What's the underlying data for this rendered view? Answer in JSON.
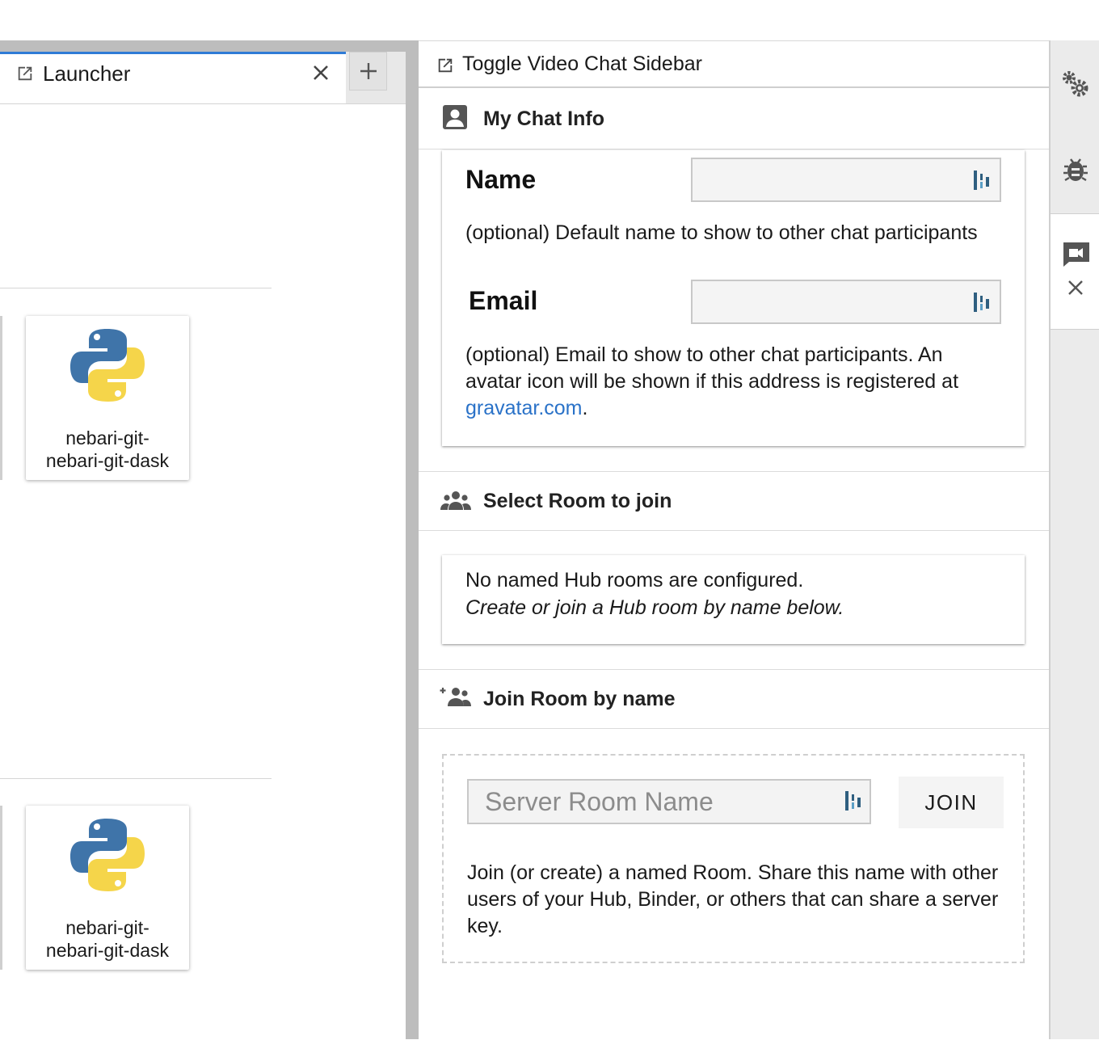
{
  "launcher_tab": {
    "label": "Launcher",
    "icon": "external-link-icon",
    "close_icon": "close-icon",
    "add_icon": "plus-icon"
  },
  "kernels": [
    {
      "name": "nebari-git-nebari-git-dask",
      "icon": "python-logo"
    },
    {
      "name": "nebari-git-nebari-git-dask",
      "icon": "python-logo"
    }
  ],
  "chat_panel": {
    "title": "Toggle Video Chat Sidebar",
    "my_chat_info": {
      "title": "My Chat Info",
      "name_label": "Name",
      "name_value": "",
      "name_help": "(optional) Default name to show to other chat participants",
      "email_label": "Email",
      "email_value": "",
      "email_help_prefix": "(optional) Email to show to other chat participants. An avatar icon will be shown if this address is registered at ",
      "email_help_link": "gravatar.com",
      "email_help_suffix": "."
    },
    "select_room": {
      "title": "Select Room to join",
      "empty_line1": "No named Hub rooms are configured.",
      "empty_line2": "Create or join a Hub room by name below."
    },
    "join_room": {
      "title": "Join Room by name",
      "input_placeholder": "Server Room Name",
      "input_value": "",
      "join_label": "JOIN",
      "help": "Join (or create) a named Room. Share this name with other users of your Hub, Binder, or others that can share a server key."
    }
  },
  "right_rail": {
    "items": [
      "settings-gears-icon",
      "debugger-bug-icon",
      "video-chat-icon"
    ],
    "close_icon": "close-icon"
  },
  "colors": {
    "accent": "#2f7bd6",
    "link": "#2a72c8",
    "splitter": "#bdbdbd"
  }
}
